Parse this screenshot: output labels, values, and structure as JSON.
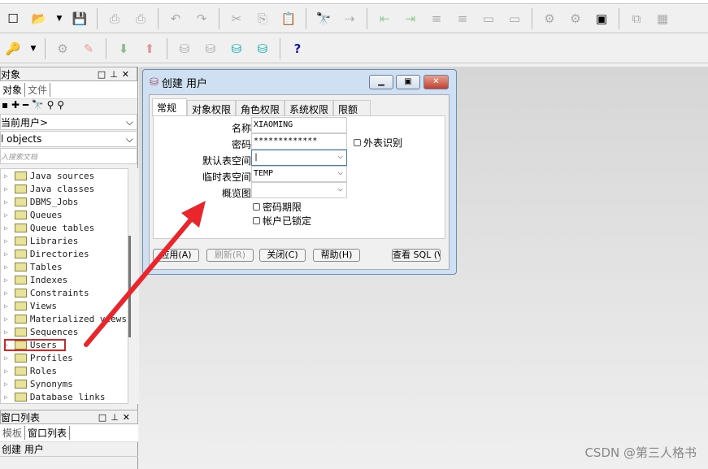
{
  "toolbar1": [
    "new-icon",
    "open-folder-icon",
    "dropdown-icon",
    "save-icon",
    "print-icon",
    "print-preview-icon",
    "undo-icon",
    "redo-icon",
    "cut-icon",
    "copy-icon",
    "paste-icon",
    "find-icon",
    "find-next-icon",
    "indent-icon",
    "unindent-icon"
  ],
  "toolbar2": [
    "key-icon",
    "dropdown-icon",
    "settings-icon",
    "pen-icon",
    "import-icon",
    "export-icon",
    "db-light-icon",
    "sql-db-icon",
    "db-find-icon",
    "db-delete-icon",
    "help-icon"
  ],
  "left": {
    "objects_panel_title": "对象",
    "tabs": [
      "对象",
      "文件"
    ],
    "user_select": "当前用户>",
    "type_select": "l objects",
    "search_placeholder": "入搜索文档",
    "tree": [
      "Java sources",
      "Java classes",
      "DBMS_Jobs",
      "Queues",
      "Queue tables",
      "Libraries",
      "Directories",
      "Tables",
      "Indexes",
      "Constraints",
      "Views",
      "Materialized views",
      "Sequences",
      "Users",
      "Profiles",
      "Roles",
      "Synonyms",
      "Database links"
    ],
    "window_panel_title": "窗口列表",
    "window_tabs": [
      "模板",
      "窗口列表"
    ],
    "window_item": "创建 用户"
  },
  "dialog": {
    "title": "创建 用户",
    "tabs": [
      "常规",
      "对象权限",
      "角色权限",
      "系统权限",
      "限额"
    ],
    "fields": {
      "name_label": "名称",
      "name_value": "XIAOMING",
      "password_label": "密码",
      "password_value": "*************",
      "default_ts_label": "默认表空间",
      "default_ts_value": "|",
      "temp_ts_label": "临时表空间",
      "temp_ts_value": "TEMP",
      "profile_label": "概览图",
      "profile_value": ""
    },
    "external_label": "外表识别",
    "password_expire_label": "密码期限",
    "account_locked_label": "帐户已锁定",
    "buttons": {
      "apply": "应用(A)",
      "refresh": "刷新(R)",
      "close": "关闭(C)",
      "help": "帮助(H)",
      "view_sql": "查看 SQL (V"
    }
  },
  "watermark": "CSDN @第三人格书"
}
